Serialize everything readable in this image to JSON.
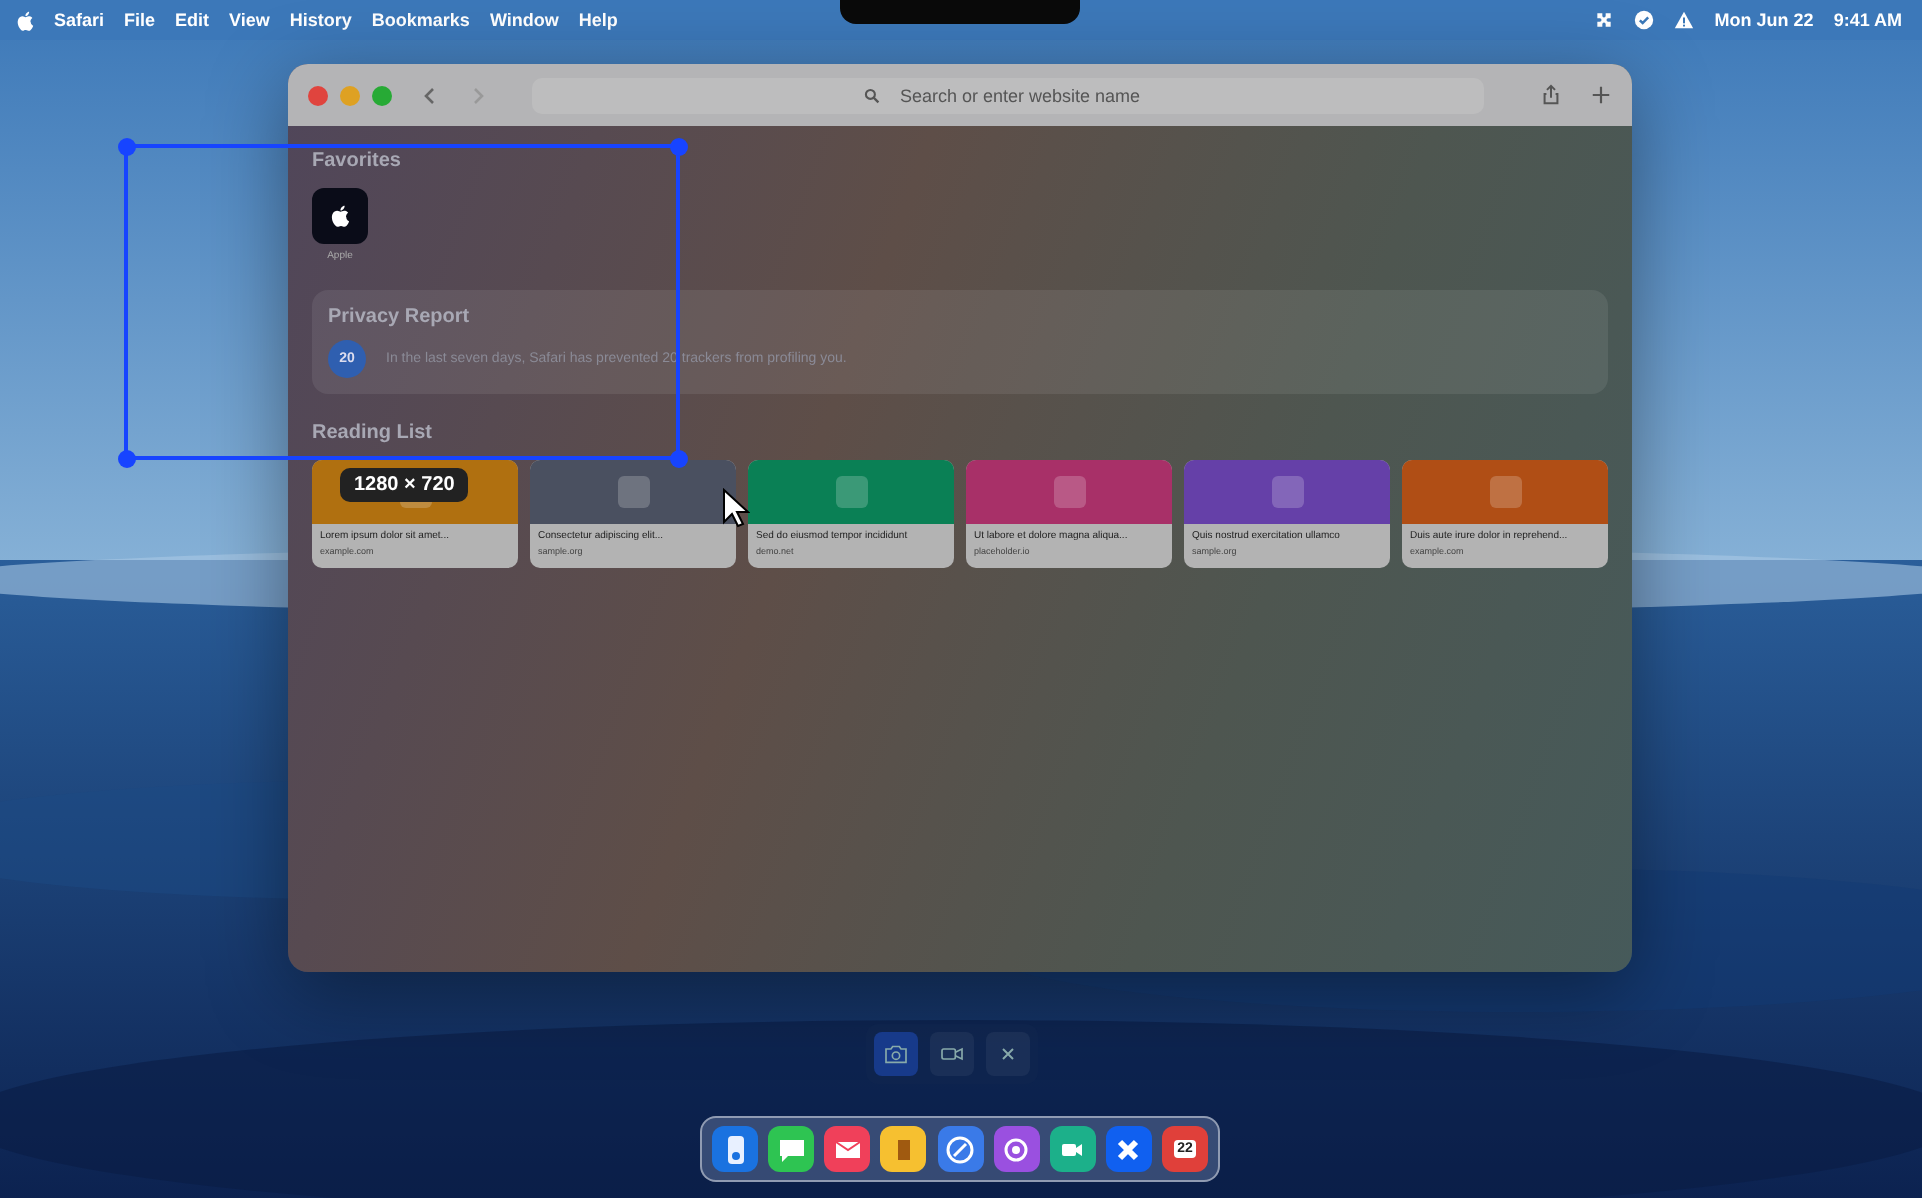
{
  "menu_bar": {
    "items": [
      "Safari",
      "File",
      "Edit",
      "View",
      "History",
      "Bookmarks",
      "Window",
      "Help"
    ],
    "date": "Mon Jun 22",
    "time": "9:41 AM"
  },
  "browser": {
    "address_placeholder": "Search or enter website name",
    "favorites_title": "Favorites",
    "favorites": [
      {
        "label": "Apple"
      }
    ],
    "privacy": {
      "title": "Privacy Report",
      "count": "20",
      "text": "In the last seven days, Safari has prevented 20 trackers from profiling you."
    },
    "reading_list_title": "Reading List",
    "reading_list": [
      {
        "title": "Lorem ipsum dolor sit amet...",
        "domain": "example.com",
        "color": "#b07010"
      },
      {
        "title": "Consectetur adipiscing elit...",
        "domain": "sample.org",
        "color": "#4a5060"
      },
      {
        "title": "Sed do eiusmod tempor incididunt",
        "domain": "demo.net",
        "color": "#0a8055"
      },
      {
        "title": "Ut labore et dolore magna aliqua...",
        "domain": "placeholder.io",
        "color": "#a83068"
      },
      {
        "title": "Quis nostrud exercitation ullamco",
        "domain": "sample.org",
        "color": "#6540a8"
      },
      {
        "title": "Duis aute irure dolor in reprehend...",
        "domain": "example.com",
        "color": "#b04e15"
      }
    ]
  },
  "selection": {
    "size": "1280 × 720"
  },
  "capture_toolbar": [
    {
      "kind": "screenshot",
      "selected": true
    },
    {
      "kind": "record",
      "selected": false
    },
    {
      "kind": "close",
      "selected": false
    }
  ],
  "dock": [
    {
      "kind": "finder",
      "color": "#1a72e0"
    },
    {
      "kind": "messages",
      "color": "#2ec452"
    },
    {
      "kind": "mail",
      "color": "#f0405a"
    },
    {
      "kind": "notes",
      "color": "#f6c030"
    },
    {
      "kind": "safari",
      "color": "#3a7ae8"
    },
    {
      "kind": "podcasts",
      "color": "#9a50e0"
    },
    {
      "kind": "facetime",
      "color": "#1cb08a"
    },
    {
      "kind": "appstore",
      "color": "#1060f0"
    },
    {
      "kind": "calendar",
      "color": "#e0403a",
      "date": "22"
    }
  ]
}
